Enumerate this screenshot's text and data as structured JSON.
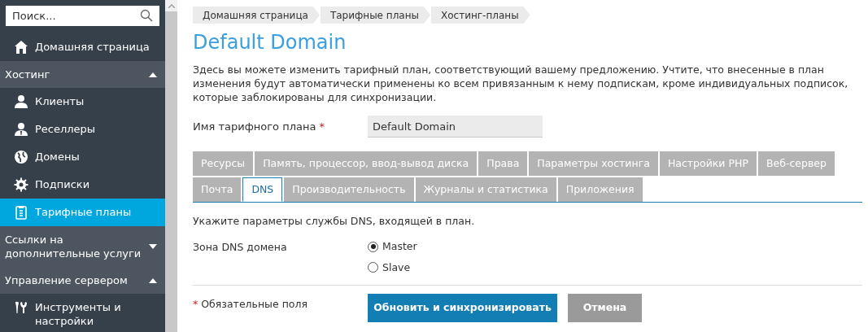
{
  "sidebar": {
    "search": {
      "placeholder": "Поиск..."
    },
    "sections": [
      {
        "kind": "item",
        "label": "Домашняя страница",
        "selected": false
      },
      {
        "kind": "header",
        "label": "Хостинг",
        "expanded": true
      },
      {
        "kind": "item",
        "label": "Клиенты",
        "selected": false
      },
      {
        "kind": "item",
        "label": "Реселлеры",
        "selected": false
      },
      {
        "kind": "item",
        "label": "Домены",
        "selected": false
      },
      {
        "kind": "item",
        "label": "Подписки",
        "selected": false
      },
      {
        "kind": "item",
        "label": "Тарифные планы",
        "selected": true
      },
      {
        "kind": "header",
        "label": "Ссылки на дополнительные услуги",
        "expanded": false
      },
      {
        "kind": "header",
        "label": "Управление сервером",
        "expanded": true
      },
      {
        "kind": "item",
        "label": "Инструменты и настройки",
        "selected": false
      }
    ]
  },
  "breadcrumbs": [
    "Домашняя страница",
    "Тарифные планы",
    "Хостинг-планы"
  ],
  "title": "Default Domain",
  "description": "Здесь вы можете изменить тарифный план, соответствующий вашему предложению. Учтите, что внесенные в план изменения будут автоматически применены ко всем привязанным к нему подпискам, кроме индивидуальных подписок, которые заблокированы для синхронизации.",
  "plan_name": {
    "label": "Имя тарифного плана",
    "required_mark": "*",
    "value": "Default Domain"
  },
  "tabs": [
    [
      {
        "label": "Ресурсы",
        "selected": false
      },
      {
        "label": "Память, процессор, ввод-вывод диска",
        "selected": false
      },
      {
        "label": "Права",
        "selected": false
      },
      {
        "label": "Параметры хостинга",
        "selected": false
      },
      {
        "label": "Настройки PHP",
        "selected": false
      },
      {
        "label": "Веб-сервер",
        "selected": false
      }
    ],
    [
      {
        "label": "Почта",
        "selected": false
      },
      {
        "label": "DNS",
        "selected": true
      },
      {
        "label": "Производительность",
        "selected": false
      },
      {
        "label": "Журналы и статистика",
        "selected": false
      },
      {
        "label": "Приложения",
        "selected": false
      }
    ]
  ],
  "tab_hint": "Укажите параметры службы DNS, входящей в план.",
  "dns_zone": {
    "label": "Зона DNS домена",
    "options": [
      {
        "label": "Master",
        "selected": true
      },
      {
        "label": "Slave",
        "selected": false
      }
    ]
  },
  "required_note": {
    "mark": "*",
    "text": "Обязательные поля"
  },
  "buttons": [
    {
      "kind": "primary",
      "label": "Обновить и синхронизировать"
    },
    {
      "kind": "secondary",
      "label": "Отмена"
    }
  ]
}
